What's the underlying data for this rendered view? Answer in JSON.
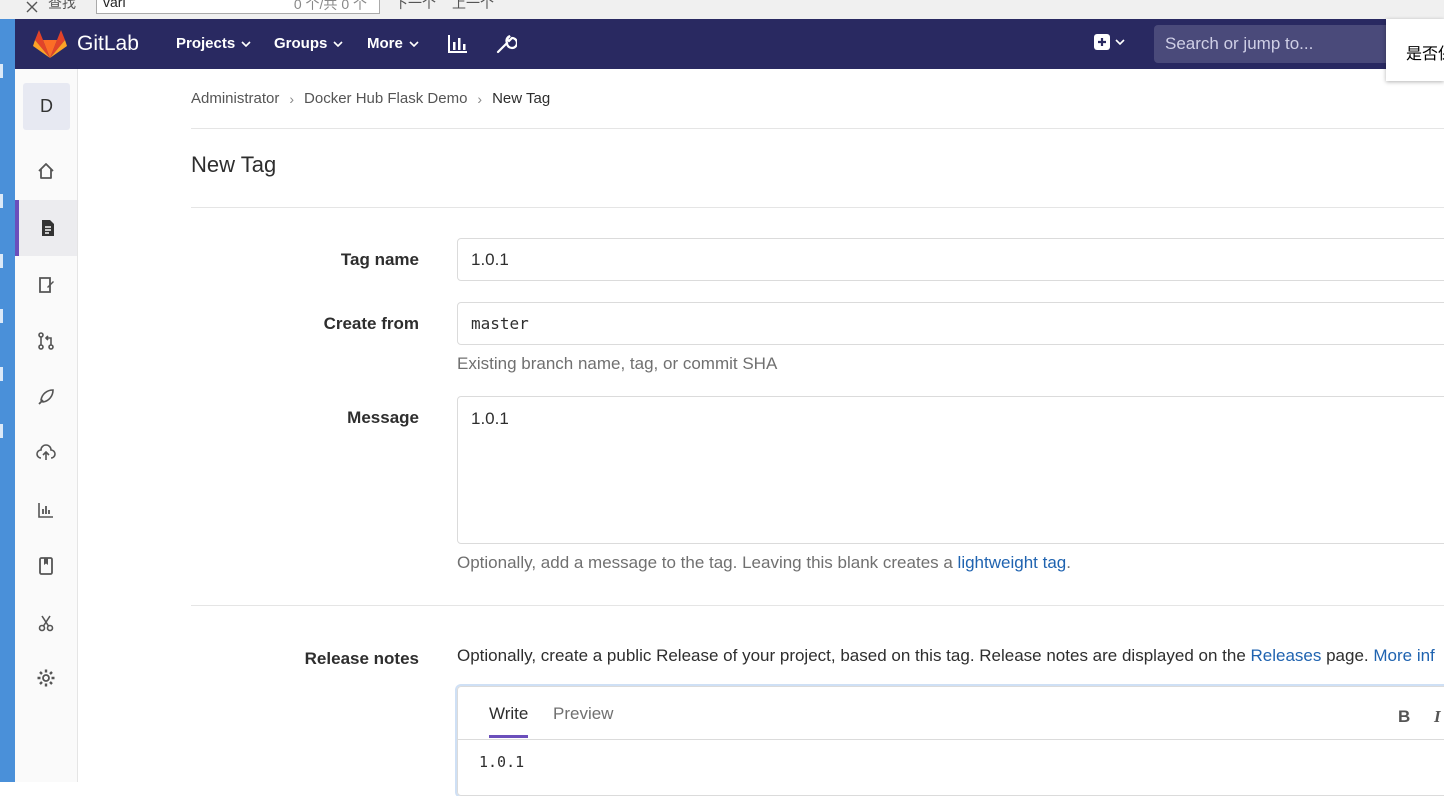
{
  "find_bar": {
    "close_glyph": "✕",
    "label": "查找",
    "value": "vari",
    "count": "0 个/共 0 个",
    "next": "下一个",
    "prev": "上一个"
  },
  "navbar": {
    "brand": "GitLab",
    "menu": [
      "Projects",
      "Groups",
      "More"
    ],
    "icons": [
      "chart-icon",
      "wrench-icon",
      "plus-square-icon"
    ],
    "search_placeholder": "Search or jump to...",
    "bg_color": "#292961"
  },
  "popup": {
    "text": "是否保存"
  },
  "sidebar": {
    "avatar_letter": "D",
    "items": [
      "home-icon",
      "repository-icon",
      "issues-icon",
      "merge-request-icon",
      "ci-cd-icon",
      "operations-icon",
      "analytics-icon",
      "wiki-icon",
      "snippets-icon",
      "settings-icon"
    ],
    "active": "repository-icon"
  },
  "breadcrumb": {
    "items": [
      "Administrator",
      "Docker Hub Flask Demo",
      "New Tag"
    ],
    "separator": "›"
  },
  "page": {
    "title": "New Tag",
    "tag_name": {
      "label": "Tag name",
      "value": "1.0.1"
    },
    "create_from": {
      "label": "Create from",
      "value": "master",
      "help": "Existing branch name, tag, or commit SHA"
    },
    "message": {
      "label": "Message",
      "value": "1.0.1",
      "help_prefix": "Optionally, add a message to the tag. Leaving this blank creates a ",
      "help_link": "lightweight tag",
      "help_suffix": "."
    },
    "release_notes": {
      "label": "Release notes",
      "intro_prefix": "Optionally, create a public Release of your project, based on this tag. Release notes are displayed on the ",
      "releases_link": "Releases",
      "intro_mid": " page. ",
      "more_link": "More inf",
      "tab_write": "Write",
      "tab_preview": "Preview",
      "toolbar_bold": "B",
      "toolbar_italic": "I",
      "value": "1.0.1"
    }
  },
  "accent_color": "#6b4fbb",
  "link_color": "#1f63b0"
}
